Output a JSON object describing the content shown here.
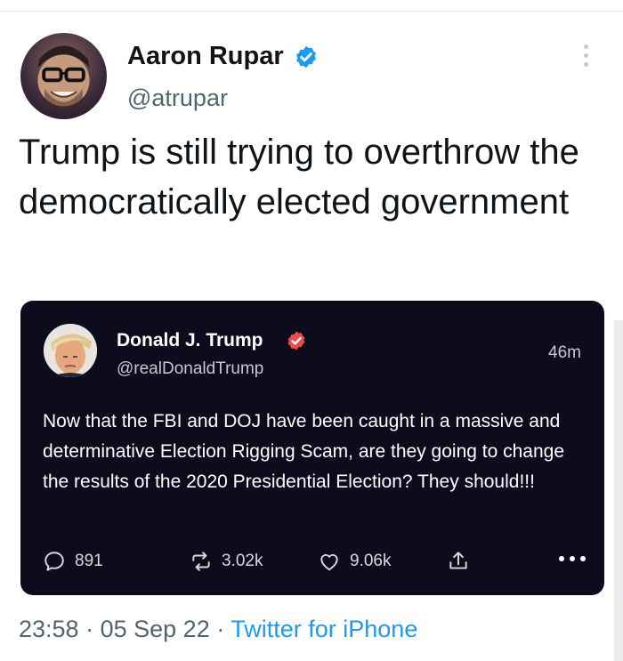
{
  "tweet": {
    "author_name": "Aaron Rupar",
    "author_handle": "@atrupar",
    "text": "Trump is still trying to overthrow the democratically elected government",
    "time": "23:58",
    "date": "05 Sep 22",
    "separator": "·",
    "source": "Twitter for iPhone"
  },
  "quote": {
    "author_name": "Donald J. Trump",
    "author_handle": "@realDonaldTrump",
    "time_ago": "46m",
    "text": "Now that the FBI and DOJ have been caught in a massive and determinative Election Rigging Scam, are they going to change the results of the 2020 Presidential Election? They should!!!",
    "replies": "891",
    "restruths": "3.02k",
    "likes": "9.06k"
  },
  "icons": {
    "verified_main": "verified-badge-icon",
    "verified_quote": "verified-badge-icon",
    "more": "more-vertical-icon",
    "reply": "reply-bubble-icon",
    "restruth": "repost-arrows-icon",
    "like": "heart-icon",
    "share": "share-icon",
    "quote_more": "more-horizontal-icon"
  },
  "colors": {
    "link_blue": "#1d9bf0",
    "quote_background": "#0d0c1d",
    "truth_badge": "#ec4b4b",
    "muted_text": "#536471"
  }
}
